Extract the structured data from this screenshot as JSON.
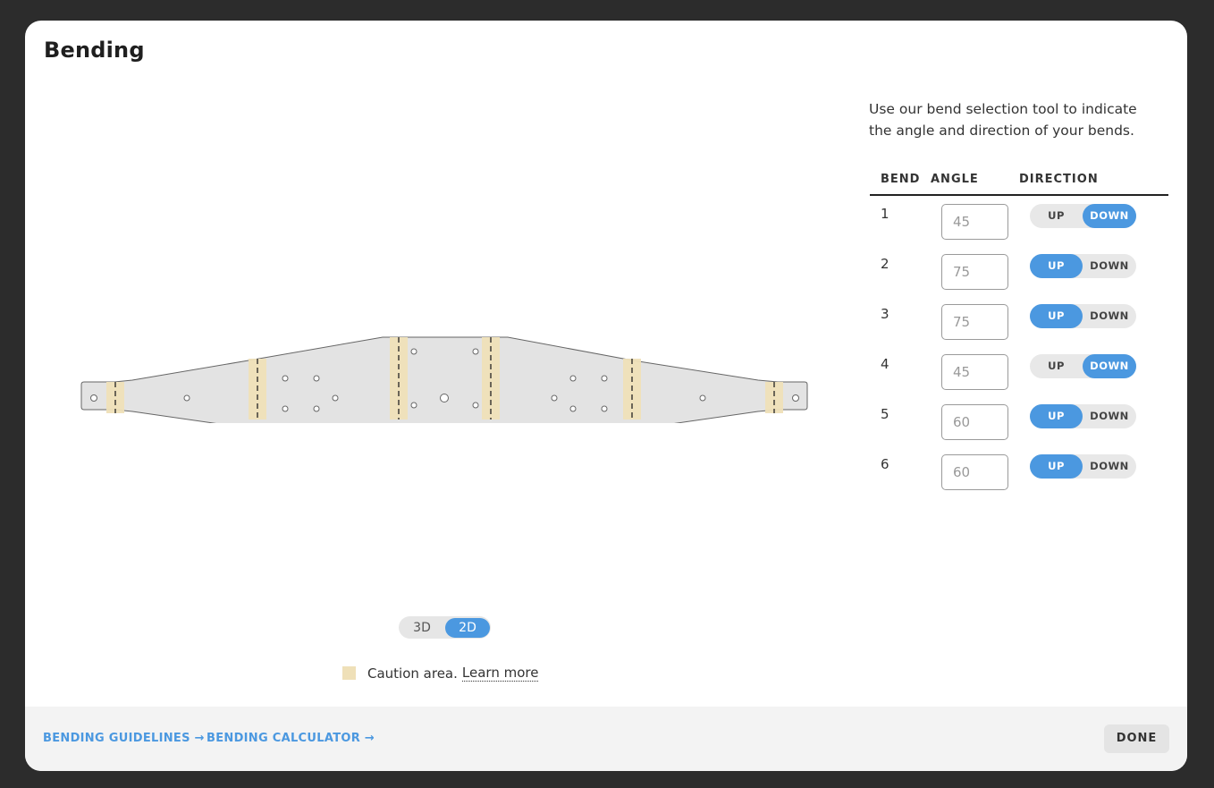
{
  "dialog": {
    "title": "Bending",
    "description": "Use our bend selection tool to indicate the angle and direction of your bends."
  },
  "view_toggle": {
    "options": [
      "3D",
      "2D"
    ],
    "selected": "2D"
  },
  "legend": {
    "text": "Caution area.",
    "link": "Learn more"
  },
  "table": {
    "headers": {
      "bend": "BEND",
      "angle": "ANGLE",
      "direction": "DIRECTION"
    },
    "direction_labels": {
      "up": "UP",
      "down": "DOWN"
    },
    "rows": [
      {
        "bend": "1",
        "angle": "45",
        "direction": "DOWN"
      },
      {
        "bend": "2",
        "angle": "75",
        "direction": "UP"
      },
      {
        "bend": "3",
        "angle": "75",
        "direction": "UP"
      },
      {
        "bend": "4",
        "angle": "45",
        "direction": "DOWN"
      },
      {
        "bend": "5",
        "angle": "60",
        "direction": "UP"
      },
      {
        "bend": "6",
        "angle": "60",
        "direction": "UP"
      }
    ]
  },
  "footer": {
    "guidelines": "BENDING GUIDELINES",
    "calculator": "BENDING CALCULATOR",
    "done": "DONE"
  },
  "colors": {
    "accent": "#4b98e0",
    "caution": "#efe0b8",
    "part_fill": "#e3e3e3"
  }
}
